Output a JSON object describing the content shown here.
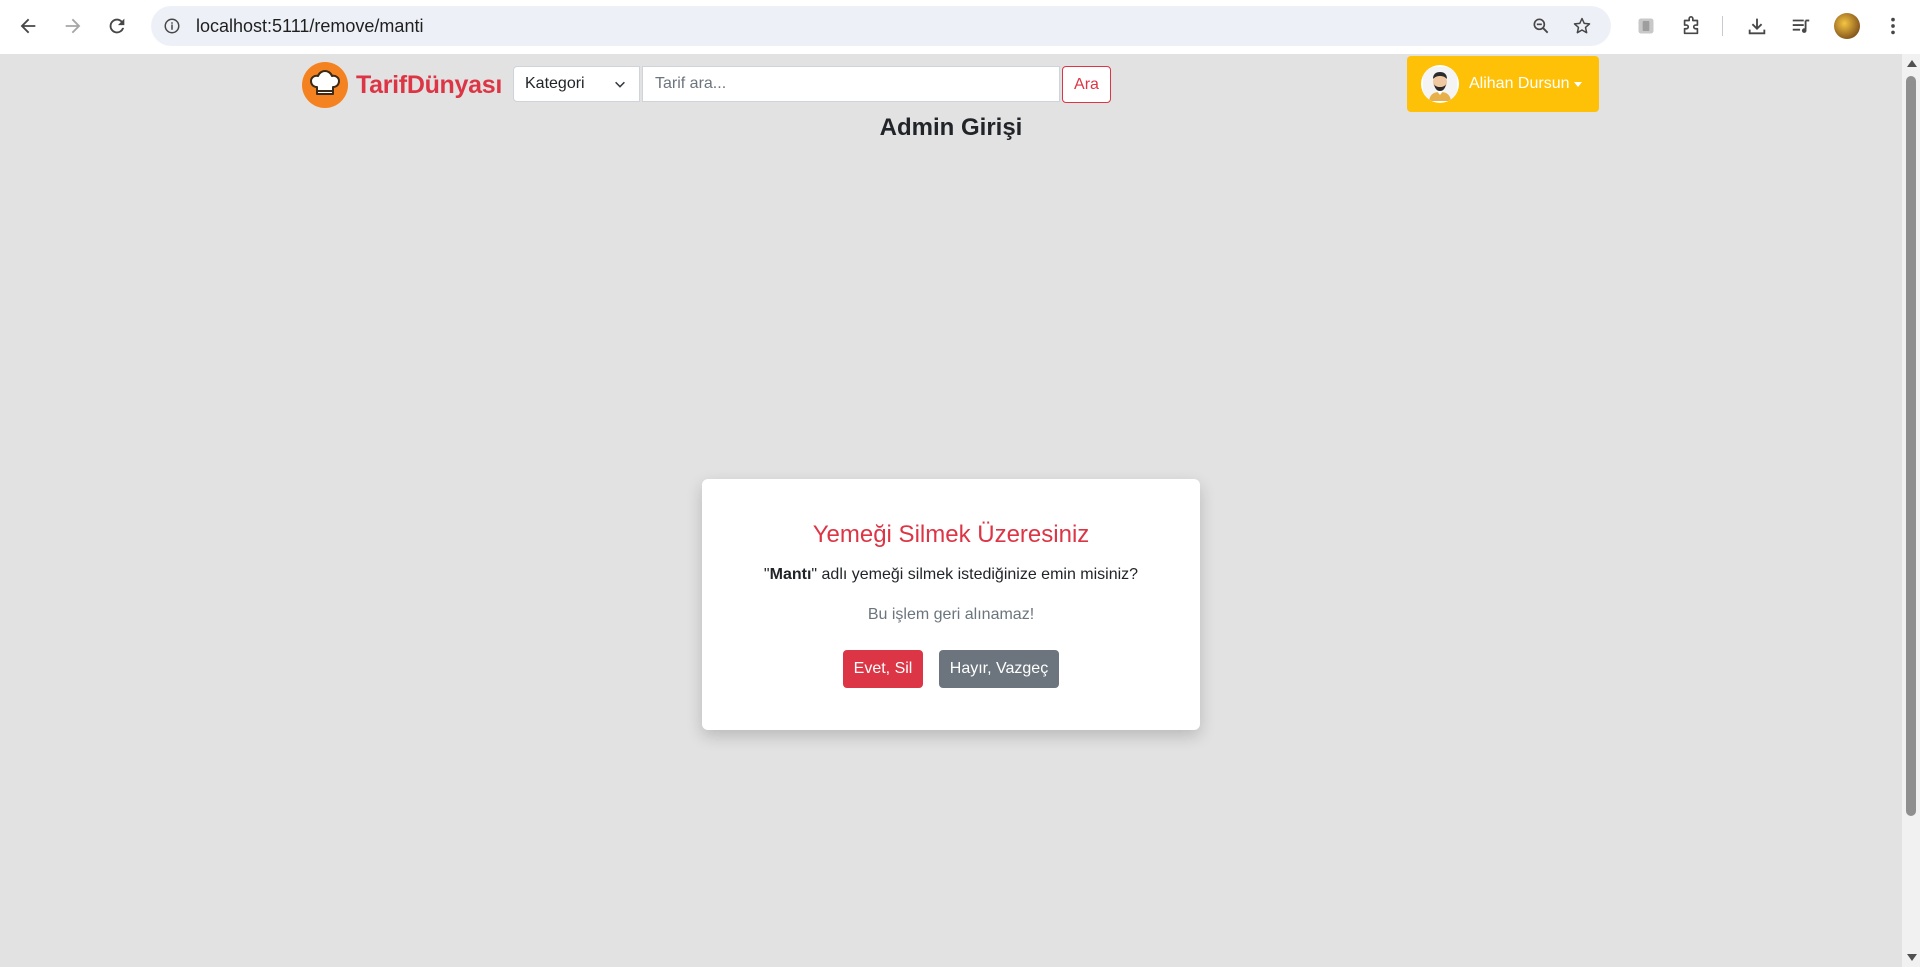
{
  "browser": {
    "url": "localhost:5111/remove/manti"
  },
  "site": {
    "brand_name": "TarifDünyası",
    "category_select": "Kategori",
    "search_placeholder": "Tarif ara...",
    "search_button": "Ara",
    "user_name": "Alihan Dursun",
    "page_title": "Admin Girişi"
  },
  "modal": {
    "title": "Yemeği Silmek Üzeresiniz",
    "question_quote_open": "\"",
    "dish_name": "Mantı",
    "question_rest": "\" adlı yemeği silmek istediğinize emin misiniz?",
    "warning": "Bu işlem geri alınamaz!",
    "confirm_label": "Evet, Sil",
    "cancel_label": "Hayır, Vazgeç"
  },
  "colors": {
    "danger": "#dc3545",
    "warning": "#ffc107",
    "secondary": "#6c757d",
    "brand_orange": "#f58220",
    "page_background": "#e2e2e2"
  },
  "icons": [
    "back-icon",
    "forward-icon",
    "reload-icon",
    "info-icon",
    "zoom-icon",
    "star-icon",
    "extension-badge-icon",
    "puzzle-icon",
    "download-icon",
    "media-icon",
    "menu-icon",
    "chef-hat-icon",
    "chevron-down-icon"
  ]
}
